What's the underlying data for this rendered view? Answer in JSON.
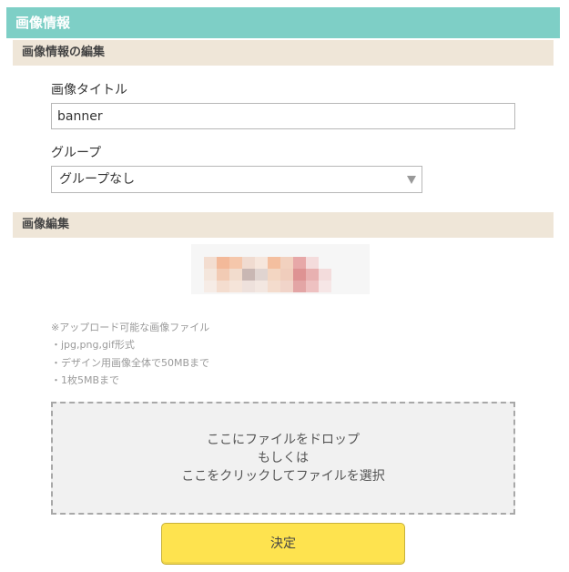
{
  "header": {
    "title": "画像情報"
  },
  "edit_info": {
    "section_title": "画像情報の編集",
    "title_label": "画像タイトル",
    "title_value": "banner",
    "group_label": "グループ",
    "group_selected": "グループなし"
  },
  "image_edit": {
    "section_title": "画像編集",
    "notes": [
      "※アップロード可能な画像ファイル",
      "・jpg,png,gif形式",
      "・デザイン用画像全体で50MBまで",
      "・1枚5MBまで"
    ],
    "dropzone_lines": [
      "ここにファイルをドロップ",
      "もしくは",
      "ここをクリックしてファイルを選択"
    ]
  },
  "submit_label": "決定",
  "colors": {
    "header_bg": "#7ecfc6",
    "section_bg": "#efe6d8",
    "submit_bg": "#fee34f"
  },
  "icons": {
    "select_arrow": "chevron-down-icon"
  }
}
